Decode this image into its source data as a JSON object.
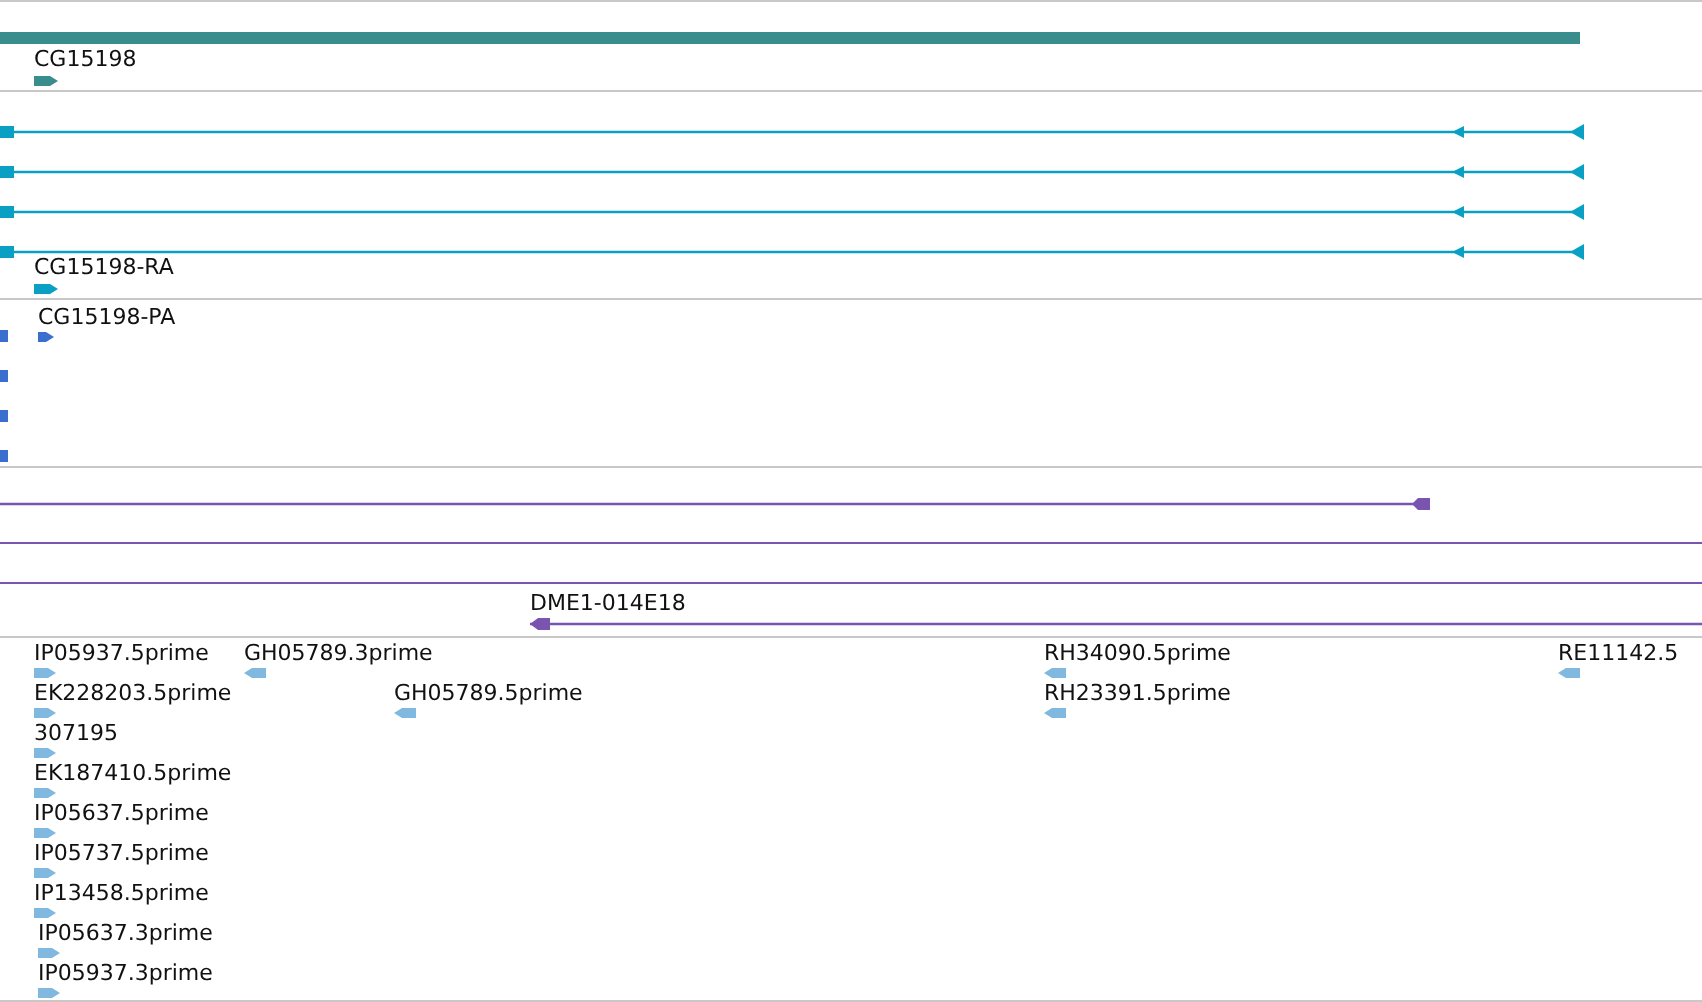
{
  "tracks": [
    {
      "kind": "gene",
      "label": "CG15198",
      "reverse": false
    },
    {
      "kind": "transcript",
      "label": "CG15198-RA",
      "reverse": false
    },
    {
      "kind": "protein",
      "label": "CG15198-PA",
      "reverse": false
    },
    {
      "kind": "clone",
      "label": "DME1-014E18",
      "reverse": true
    },
    {
      "kind": "est",
      "features": [
        {
          "label": "IP05937.5prime",
          "reverse": false
        },
        {
          "label": "GH05789.3prime",
          "reverse": true
        },
        {
          "label": "EK228203.5prime",
          "reverse": false
        },
        {
          "label": "GH05789.5prime",
          "reverse": true
        },
        {
          "label": "307195",
          "reverse": false
        },
        {
          "label": "EK187410.5prime",
          "reverse": false
        },
        {
          "label": "IP05637.5prime",
          "reverse": false
        },
        {
          "label": "IP05737.5prime",
          "reverse": false
        },
        {
          "label": "IP13458.5prime",
          "reverse": false
        },
        {
          "label": "IP05637.3prime",
          "reverse": false
        },
        {
          "label": "IP05937.3prime",
          "reverse": false
        },
        {
          "label": "RH34090.5prime",
          "reverse": true
        },
        {
          "label": "RH23391.5prime",
          "reverse": true
        },
        {
          "label": "RE11142.5",
          "reverse": true
        }
      ]
    }
  ]
}
